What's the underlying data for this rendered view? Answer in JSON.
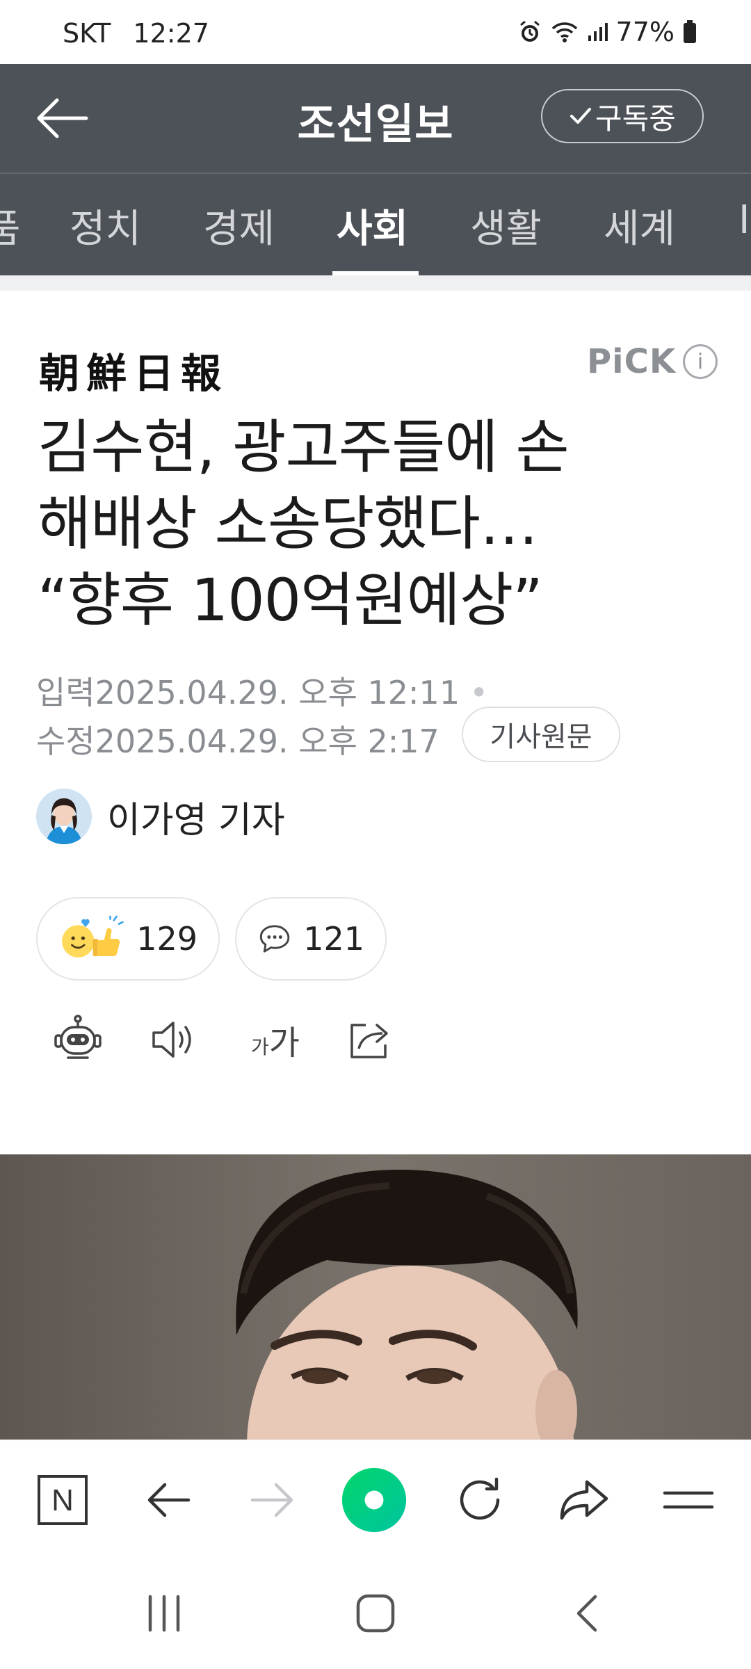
{
  "status_bar": {
    "carrier": "SKT",
    "time": "12:27",
    "battery": "77%",
    "icons": [
      "alarm-icon",
      "wifi-icon",
      "signal-icon",
      "battery-icon"
    ]
  },
  "header": {
    "title": "조선일보",
    "subscribe_label": "구독중"
  },
  "tabs": {
    "items": [
      {
        "label": "품"
      },
      {
        "label": "정치"
      },
      {
        "label": "경제"
      },
      {
        "label": "사회",
        "active": true
      },
      {
        "label": "생활"
      },
      {
        "label": "세계"
      },
      {
        "label": "I"
      }
    ]
  },
  "article": {
    "press_logo": "朝鮮日報",
    "pick_label": "PiCK",
    "pick_info": "i",
    "headline_lines": [
      "김수현, 광고주들에 손",
      "해배상 소송당했다…",
      "“향후 100억원예상”"
    ],
    "input_label": "입력",
    "input_date": "2025.04.29. 오후 12:11",
    "modified_label": "수정",
    "modified_date": "2025.04.29. 오후 2:17",
    "original_link_label": "기사원문",
    "reporter_name": "이가영 기자",
    "reaction_count": "129",
    "comment_count": "121",
    "font_size_label_small": "가",
    "font_size_label_large": "가"
  },
  "browser_bar": {
    "buttons": [
      "naver-home-icon",
      "back-arrow-icon",
      "forward-arrow-icon",
      "green-dot-icon",
      "reload-icon",
      "share-icon",
      "menu-icon"
    ],
    "home_letter": "N"
  },
  "colors": {
    "header_bg": "#4d5158",
    "accent_green": "#03c75a",
    "meta_gray": "#8a8d91"
  }
}
